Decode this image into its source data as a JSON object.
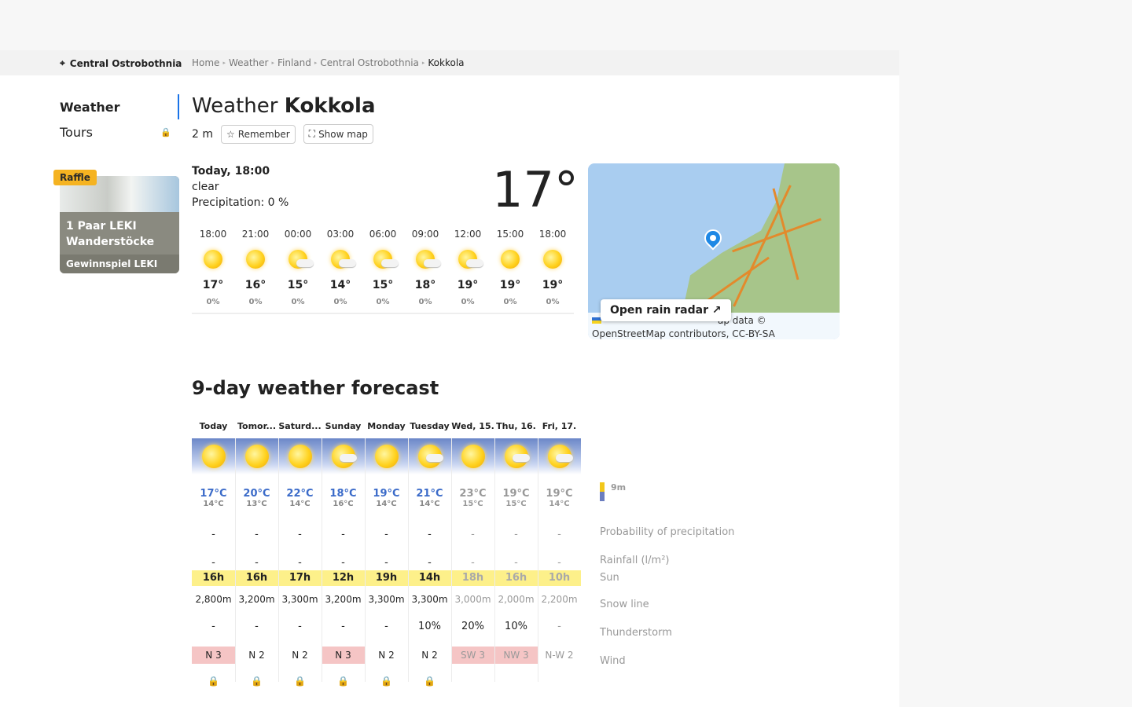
{
  "breadcrumb_region": "Central Ostrobothnia",
  "breadcrumbs": [
    "Home",
    "Weather",
    "Finland",
    "Central Ostrobothnia",
    "Kokkola"
  ],
  "sidenav": {
    "weather": "Weather",
    "tours": "Tours"
  },
  "promo": {
    "badge": "Raffle",
    "title": "1 Paar LEKI Wanderstöcke",
    "sub": "Gewinnspiel LEKI"
  },
  "header": {
    "title_prefix": "Weather",
    "city": "Kokkola",
    "altitude": "2 m",
    "remember": "Remember",
    "show_map": "Show map"
  },
  "current": {
    "when": "Today, 18:00",
    "condition": "clear",
    "precip": "Precipitation: 0 %",
    "temp": "17°"
  },
  "hourly": [
    {
      "time": "18:00",
      "temp": "17°",
      "precip": "0%",
      "icon": "sun-icon"
    },
    {
      "time": "21:00",
      "temp": "16°",
      "precip": "0%",
      "icon": "sun-icon"
    },
    {
      "time": "00:00",
      "temp": "15°",
      "precip": "0%",
      "icon": "sun-cloud-icon"
    },
    {
      "time": "03:00",
      "temp": "14°",
      "precip": "0%",
      "icon": "sun-cloud-icon"
    },
    {
      "time": "06:00",
      "temp": "15°",
      "precip": "0%",
      "icon": "sun-cloud-icon"
    },
    {
      "time": "09:00",
      "temp": "18°",
      "precip": "0%",
      "icon": "sun-cloud-icon"
    },
    {
      "time": "12:00",
      "temp": "19°",
      "precip": "0%",
      "icon": "sun-cloud-icon"
    },
    {
      "time": "15:00",
      "temp": "19°",
      "precip": "0%",
      "icon": "sun-icon"
    },
    {
      "time": "18:00",
      "temp": "19°",
      "precip": "0%",
      "icon": "sun-icon"
    }
  ],
  "map": {
    "radar_button": "Open rain radar",
    "attribution_1": "ap data ©",
    "attribution_2": "OpenStreetMap contributors, CC-BY-SA"
  },
  "forecast": {
    "title": "9-day weather forecast",
    "days": [
      {
        "day": "Today",
        "max": "17°C",
        "min": "14°C",
        "prob": "-",
        "rain": "-",
        "sun": "16h",
        "snow": "2,800m",
        "thunder": "-",
        "wind": "N 3",
        "wind_hi": true,
        "icon": "sun-icon",
        "locked": false
      },
      {
        "day": "Tomor...",
        "max": "20°C",
        "min": "13°C",
        "prob": "-",
        "rain": "-",
        "sun": "16h",
        "snow": "3,200m",
        "thunder": "-",
        "wind": "N 2",
        "wind_hi": false,
        "icon": "sun-icon",
        "locked": false
      },
      {
        "day": "Saturd...",
        "max": "22°C",
        "min": "14°C",
        "prob": "-",
        "rain": "-",
        "sun": "17h",
        "snow": "3,300m",
        "thunder": "-",
        "wind": "N 2",
        "wind_hi": false,
        "icon": "sun-icon",
        "locked": false
      },
      {
        "day": "Sunday",
        "max": "18°C",
        "min": "16°C",
        "prob": "-",
        "rain": "-",
        "sun": "12h",
        "snow": "3,200m",
        "thunder": "-",
        "wind": "N 3",
        "wind_hi": true,
        "icon": "sun-cloud-icon",
        "locked": false
      },
      {
        "day": "Monday",
        "max": "19°C",
        "min": "14°C",
        "prob": "-",
        "rain": "-",
        "sun": "19h",
        "snow": "3,300m",
        "thunder": "-",
        "wind": "N 2",
        "wind_hi": false,
        "icon": "sun-icon",
        "locked": false
      },
      {
        "day": "Tuesday",
        "max": "21°C",
        "min": "14°C",
        "prob": "-",
        "rain": "-",
        "sun": "14h",
        "snow": "3,300m",
        "thunder": "10%",
        "wind": "N 2",
        "wind_hi": false,
        "icon": "sun-cloud-icon",
        "locked": false
      },
      {
        "day": "Wed, 15.",
        "max": "23°C",
        "min": "15°C",
        "prob": "-",
        "rain": "-",
        "sun": "18h",
        "snow": "3,000m",
        "thunder": "20%",
        "wind": "SW 3",
        "wind_hi": true,
        "icon": "sun-icon",
        "locked": true
      },
      {
        "day": "Thu, 16.",
        "max": "19°C",
        "min": "15°C",
        "prob": "-",
        "rain": "-",
        "sun": "16h",
        "snow": "2,000m",
        "thunder": "10%",
        "wind": "NW 3",
        "wind_hi": true,
        "icon": "sun-cloud-icon",
        "locked": true
      },
      {
        "day": "Fri, 17.",
        "max": "19°C",
        "min": "14°C",
        "prob": "-",
        "rain": "-",
        "sun": "10h",
        "snow": "2,200m",
        "thunder": "-",
        "wind": "N-W 2",
        "wind_hi": false,
        "icon": "sun-cloud-icon",
        "locked": true
      }
    ],
    "legend": {
      "altitude_key": "9m",
      "probability": "Probability of precipitation",
      "rainfall": "Rainfall (l/m²)",
      "sun": "Sun",
      "snow_line": "Snow line",
      "thunderstorm": "Thunderstorm",
      "wind": "Wind"
    }
  },
  "colors": {
    "accent": "#1a73e8",
    "temp_blue": "#3b6bc9",
    "sun_yellow": "#fdf08a",
    "wind_red": "#f5c5c5"
  }
}
